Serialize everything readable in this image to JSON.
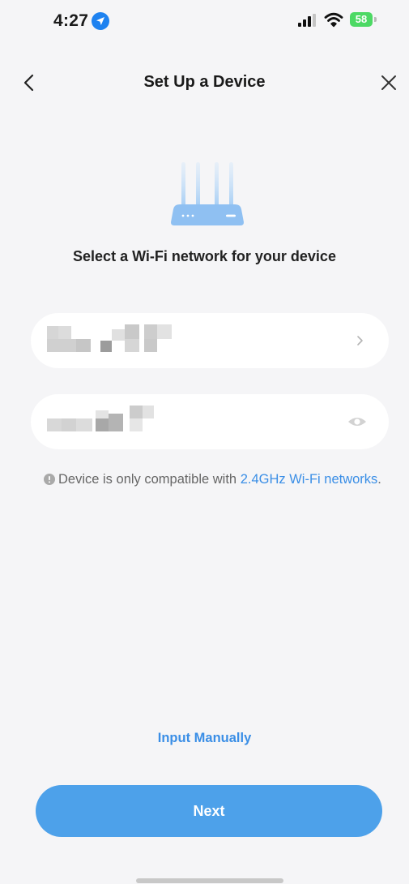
{
  "status_bar": {
    "time": "4:27",
    "battery_level": "58",
    "location_icon": "location-arrow-icon",
    "signal_icon": "cellular-signal-icon",
    "wifi_icon": "wifi-icon",
    "battery_color": "#4cd964"
  },
  "nav": {
    "title": "Set Up a Device",
    "back_icon": "chevron-left-icon",
    "close_icon": "close-icon"
  },
  "illustration": "router-icon",
  "prompt": "Select a Wi-Fi network for your device",
  "network_field": {
    "value": "",
    "obscured": true,
    "trailing_icon": "chevron-right-icon"
  },
  "password_field": {
    "value": "",
    "obscured": true,
    "trailing_icon": "eye-icon"
  },
  "notice": {
    "icon": "info-icon",
    "text_before": "Device is only compatible with ",
    "link_text": "2.4GHz Wi-Fi networks",
    "text_after": "."
  },
  "input_manually_label": "Input Manually",
  "next_label": "Next",
  "colors": {
    "accent": "#4da1ea",
    "link": "#3a8ee6",
    "background": "#f5f5f7",
    "field": "#ffffff"
  }
}
